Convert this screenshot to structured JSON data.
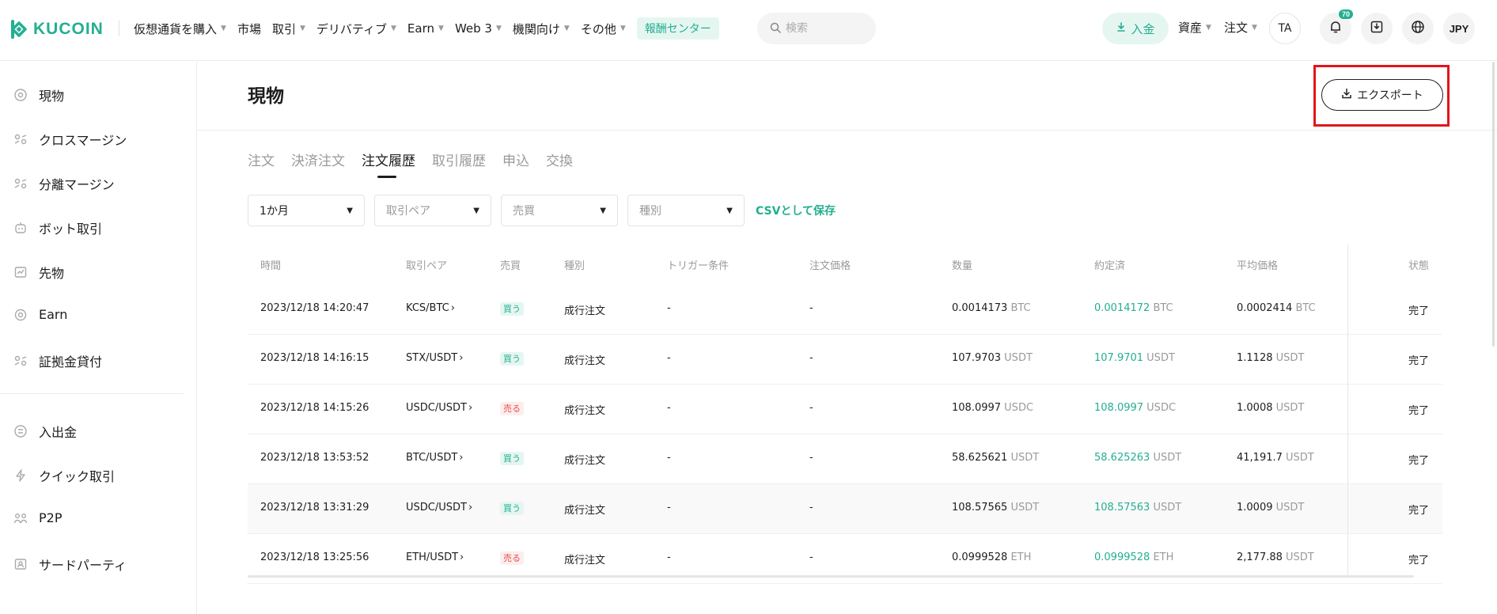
{
  "brand": {
    "name": "KUCOIN",
    "accent": "#23af91",
    "highlight": "#e3151a"
  },
  "nav": {
    "items": [
      {
        "label": "仮想通貨を購入",
        "caret": true
      },
      {
        "label": "市場",
        "caret": false
      },
      {
        "label": "取引",
        "caret": true
      },
      {
        "label": "デリバティブ",
        "caret": true
      },
      {
        "label": "Earn",
        "caret": true
      },
      {
        "label": "Web 3",
        "caret": true
      },
      {
        "label": "機関向け",
        "caret": true
      },
      {
        "label": "その他",
        "caret": true
      }
    ],
    "reward_center": "報酬センター",
    "search_placeholder": "検索",
    "deposit": "入金",
    "assets": "資産",
    "orders": "注文",
    "avatar": "TA",
    "notif_count": "70",
    "currency": "JPY"
  },
  "sidebar": {
    "items": [
      {
        "label": "現物",
        "icon": "spot-icon"
      },
      {
        "label": "クロスマージン",
        "icon": "cross-margin-icon"
      },
      {
        "label": "分離マージン",
        "icon": "isolated-margin-icon"
      },
      {
        "label": "ボット取引",
        "icon": "bot-icon"
      },
      {
        "label": "先物",
        "icon": "futures-icon"
      },
      {
        "label": "Earn",
        "icon": "earn-icon"
      },
      {
        "label": "証拠金貸付",
        "icon": "lending-icon"
      }
    ],
    "items2": [
      {
        "label": "入出金",
        "icon": "deposit-withdraw-icon"
      },
      {
        "label": "クイック取引",
        "icon": "flash-icon"
      },
      {
        "label": "P2P",
        "icon": "p2p-icon"
      },
      {
        "label": "サードパーティ",
        "icon": "third-party-icon"
      }
    ]
  },
  "page": {
    "title": "現物",
    "export": "エクスポート",
    "tabs": [
      "注文",
      "決済注文",
      "注文履歴",
      "取引履歴",
      "申込",
      "交換"
    ],
    "active_tab": 2,
    "filters": {
      "period": "1か月",
      "pair_placeholder": "取引ペア",
      "side_placeholder": "売買",
      "type_placeholder": "種別",
      "csv": "CSVとして保存"
    }
  },
  "table": {
    "headers": [
      "時間",
      "取引ペア",
      "売買",
      "種別",
      "トリガー条件",
      "注文価格",
      "数量",
      "約定済",
      "平均価格",
      "状態"
    ],
    "rows": [
      {
        "time": "2023/12/18 14:20:47",
        "pair": "KCS/BTC",
        "side": "買う",
        "side_type": "buy",
        "type": "成行注文",
        "trigger": "-",
        "price": "-",
        "qty": "0.0014173",
        "qty_unit": "BTC",
        "filled": "0.0014172",
        "filled_unit": "BTC",
        "avg": "0.0002414",
        "avg_unit": "BTC",
        "status": "完了"
      },
      {
        "time": "2023/12/18 14:16:15",
        "pair": "STX/USDT",
        "side": "買う",
        "side_type": "buy",
        "type": "成行注文",
        "trigger": "-",
        "price": "-",
        "qty": "107.9703",
        "qty_unit": "USDT",
        "filled": "107.9701",
        "filled_unit": "USDT",
        "avg": "1.1128",
        "avg_unit": "USDT",
        "status": "完了"
      },
      {
        "time": "2023/12/18 14:15:26",
        "pair": "USDC/USDT",
        "side": "売る",
        "side_type": "sell",
        "type": "成行注文",
        "trigger": "-",
        "price": "-",
        "qty": "108.0997",
        "qty_unit": "USDC",
        "filled": "108.0997",
        "filled_unit": "USDC",
        "avg": "1.0008",
        "avg_unit": "USDT",
        "status": "完了"
      },
      {
        "time": "2023/12/18 13:53:52",
        "pair": "BTC/USDT",
        "side": "買う",
        "side_type": "buy",
        "type": "成行注文",
        "trigger": "-",
        "price": "-",
        "qty": "58.625621",
        "qty_unit": "USDT",
        "filled": "58.625263",
        "filled_unit": "USDT",
        "avg": "41,191.7",
        "avg_unit": "USDT",
        "status": "完了"
      },
      {
        "time": "2023/12/18 13:31:29",
        "pair": "USDC/USDT",
        "side": "買う",
        "side_type": "buy",
        "type": "成行注文",
        "trigger": "-",
        "price": "-",
        "qty": "108.57565",
        "qty_unit": "USDT",
        "filled": "108.57563",
        "filled_unit": "USDT",
        "avg": "1.0009",
        "avg_unit": "USDT",
        "status": "完了"
      },
      {
        "time": "2023/12/18 13:25:56",
        "pair": "ETH/USDT",
        "side": "売る",
        "side_type": "sell",
        "type": "成行注文",
        "trigger": "-",
        "price": "-",
        "qty": "0.0999528",
        "qty_unit": "ETH",
        "filled": "0.0999528",
        "filled_unit": "ETH",
        "avg": "2,177.88",
        "avg_unit": "USDT",
        "status": "完了"
      }
    ]
  }
}
